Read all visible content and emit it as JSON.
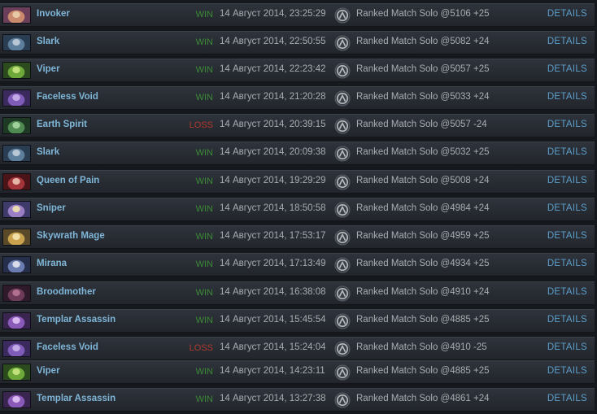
{
  "details_label": "DETAILS",
  "colors": {
    "win": "#3c8a36",
    "loss": "#b03a2e",
    "hero_name": "#7fb6d8",
    "details": "#5d9fcb"
  },
  "matches": [
    {
      "hero": "Invoker",
      "result": "WIN",
      "outcome": "win",
      "date": "14 Август 2014, 23:25:29",
      "mode": "Ranked Match Solo @5106 +25",
      "portrait": [
        "#6b3f5a",
        "#c98a6e",
        "#e7c9a8"
      ]
    },
    {
      "hero": "Slark",
      "result": "WIN",
      "outcome": "win",
      "date": "14 Август 2014, 22:50:55",
      "mode": "Ranked Match Solo @5082 +24",
      "portrait": [
        "#2a3d52",
        "#5d7f9c",
        "#b7c8d4"
      ]
    },
    {
      "hero": "Viper",
      "result": "WIN",
      "outcome": "win",
      "date": "14 Август 2014, 22:23:42",
      "mode": "Ranked Match Solo @5057 +25",
      "portrait": [
        "#2b4a1e",
        "#6ea73a",
        "#bfe07a"
      ]
    },
    {
      "hero": "Faceless Void",
      "result": "WIN",
      "outcome": "win",
      "date": "14 Август 2014, 21:20:28",
      "mode": "Ranked Match Solo @5033 +24",
      "portrait": [
        "#3b2a5e",
        "#7e5cb8",
        "#c1a9e6"
      ]
    },
    {
      "hero": "Earth Spirit",
      "result": "LOSS",
      "outcome": "loss",
      "date": "14 Август 2014, 20:39:15",
      "mode": "Ranked Match Solo @5057 -24",
      "portrait": [
        "#1e3a24",
        "#4f8a52",
        "#9ed29a"
      ]
    },
    {
      "hero": "Slark",
      "result": "WIN",
      "outcome": "win",
      "date": "14 Август 2014, 20:09:38",
      "mode": "Ranked Match Solo @5032 +25",
      "portrait": [
        "#2a3d52",
        "#5d7f9c",
        "#b7c8d4"
      ]
    },
    {
      "hero": "Queen of Pain",
      "result": "WIN",
      "outcome": "win",
      "date": "14 Август 2014, 19:29:29",
      "mode": "Ranked Match Solo @5008 +24",
      "portrait": [
        "#4a1418",
        "#a2343a",
        "#e5b6a8"
      ]
    },
    {
      "hero": "Sniper",
      "result": "WIN",
      "outcome": "win",
      "date": "14 Август 2014, 18:50:58",
      "mode": "Ranked Match Solo @4984 +24",
      "portrait": [
        "#3e3a6a",
        "#9a7fc4",
        "#e9d9b0"
      ]
    },
    {
      "hero": "Skywrath Mage",
      "result": "WIN",
      "outcome": "win",
      "date": "14 Август 2014, 17:53:17",
      "mode": "Ranked Match Solo @4959 +25",
      "portrait": [
        "#5a4a2a",
        "#c8a24e",
        "#f0e0a8"
      ]
    },
    {
      "hero": "Mirana",
      "result": "WIN",
      "outcome": "win",
      "date": "14 Август 2014, 17:13:49",
      "mode": "Ranked Match Solo @4934 +25",
      "portrait": [
        "#26304c",
        "#6a7cb0",
        "#d8dde8"
      ]
    },
    {
      "hero": "Broodmother",
      "result": "WIN",
      "outcome": "win",
      "date": "14 Август 2014, 16:38:08",
      "mode": "Ranked Match Solo @4910 +24",
      "portrait": [
        "#2e1a2a",
        "#6e3a5a",
        "#b0708e"
      ]
    },
    {
      "hero": "Templar Assassin",
      "result": "WIN",
      "outcome": "win",
      "date": "14 Август 2014, 15:45:54",
      "mode": "Ranked Match Solo @4885 +25",
      "portrait": [
        "#3a2450",
        "#8a5ab8",
        "#d8b8ee"
      ]
    },
    {
      "hero": "Faceless Void",
      "result": "LOSS",
      "outcome": "loss",
      "date": "14 Август 2014, 15:24:04",
      "mode": "Ranked Match Solo @4910 -25",
      "portrait": [
        "#3b2a5e",
        "#7e5cb8",
        "#c1a9e6"
      ]
    },
    {
      "hero": "Viper",
      "result": "WIN",
      "outcome": "win",
      "date": "14 Август 2014, 14:23:11",
      "mode": "Ranked Match Solo @4885 +25",
      "portrait": [
        "#2b4a1e",
        "#6ea73a",
        "#bfe07a"
      ]
    },
    {
      "hero": "Templar Assassin",
      "result": "WIN",
      "outcome": "win",
      "date": "14 Август 2014, 13:27:38",
      "mode": "Ranked Match Solo @4861 +24",
      "portrait": [
        "#3a2450",
        "#8a5ab8",
        "#d8b8ee"
      ]
    }
  ]
}
